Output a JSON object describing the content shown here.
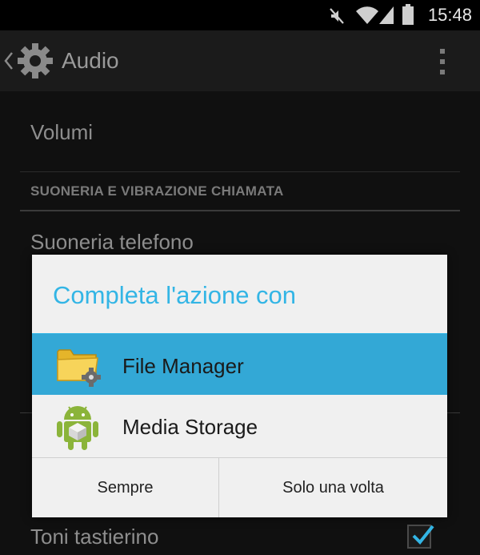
{
  "status_bar": {
    "time": "15:48",
    "icons": [
      "mute-icon",
      "wifi-icon",
      "signal-icon",
      "battery-icon"
    ]
  },
  "action_bar": {
    "title": "Audio",
    "icons": [
      "back-chevron-icon",
      "settings-gear-icon",
      "overflow-menu-icon"
    ]
  },
  "settings": {
    "volumes_label": "Volumi",
    "section_header": "SUONERIA E VIBRAZIONE CHIAMATA",
    "ringtone_label": "Suoneria telefono",
    "dial_tones_label": "Toni tastierino",
    "dial_tones_checked": true
  },
  "dialog": {
    "title": "Completa l'azione con",
    "apps": [
      {
        "label": "File Manager",
        "icon": "folder-gear-icon",
        "selected": true
      },
      {
        "label": "Media Storage",
        "icon": "android-package-icon",
        "selected": false
      }
    ],
    "buttons": {
      "always": "Sempre",
      "just_once": "Solo una volta"
    }
  },
  "colors": {
    "accent": "#33b5e5",
    "selected_row": "#33a8d6",
    "dialog_bg": "#f0f0f0",
    "screen_bg": "#101010"
  }
}
